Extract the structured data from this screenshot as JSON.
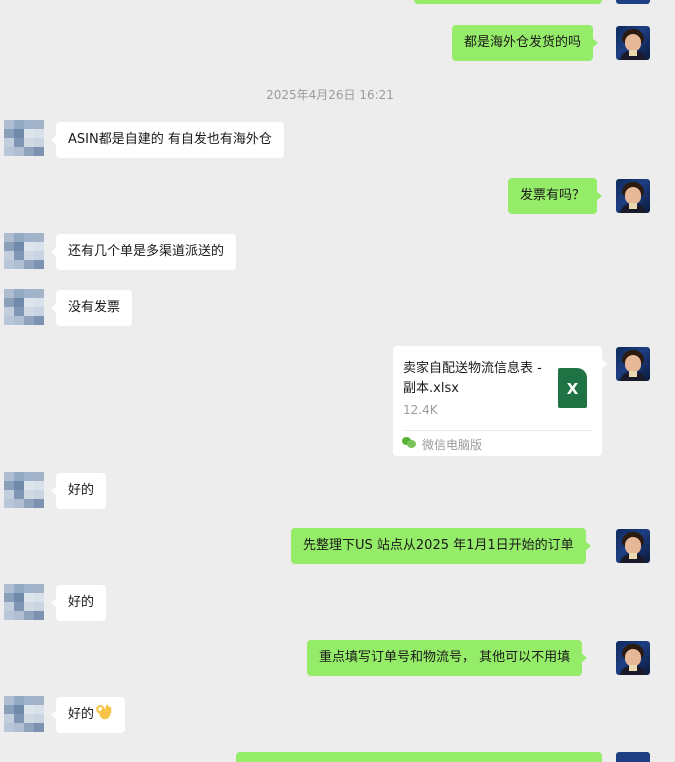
{
  "messages": [
    {
      "dir": "out",
      "text": "都是海外仓发货的吗"
    },
    {
      "timestamp": "2025年4月26日 16:21"
    },
    {
      "dir": "in",
      "text": "ASIN都是自建的 有自发也有海外仓"
    },
    {
      "dir": "out",
      "text": "发票有吗？"
    },
    {
      "dir": "in",
      "text": "还有几个单是多渠道派送的"
    },
    {
      "dir": "in",
      "text": "没有发票"
    },
    {
      "dir": "out",
      "file": {
        "name": "卖家自配送物流信息表 - 副本.xlsx",
        "size": "12.4K",
        "icon_letter": "X",
        "source": "微信电脑版"
      }
    },
    {
      "dir": "in",
      "text": "好的"
    },
    {
      "dir": "out",
      "text": "先整理下US 站点从2025 年1月1日开始的订单"
    },
    {
      "dir": "in",
      "text": "好的"
    },
    {
      "dir": "out",
      "text": "重点填写订单号和物流号， 其他可以不用填"
    },
    {
      "dir": "in",
      "text": "好的",
      "emoji": "ok-hand-emoji"
    }
  ],
  "colors": {
    "background": "#ededed",
    "outgoing_bubble": "#95ec69",
    "incoming_bubble": "#ffffff",
    "excel_icon": "#1f7244",
    "timestamp_text": "#9b9b9b"
  },
  "icons": {
    "incoming_avatar": "pixelated-avatar",
    "outgoing_avatar": "user-photo-avatar",
    "file_type": "excel-file-icon",
    "file_source": "wechat-icon"
  }
}
